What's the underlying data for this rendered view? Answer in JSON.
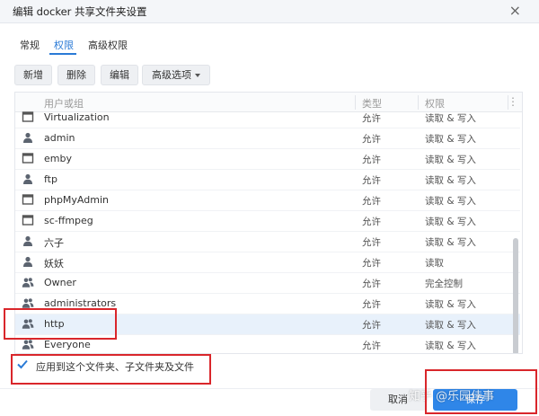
{
  "dialog": {
    "title": "编辑 docker 共享文件夹设置",
    "close_glyph": "×"
  },
  "tabs": [
    {
      "label": "常规"
    },
    {
      "label": "权限"
    },
    {
      "label": "高级权限"
    }
  ],
  "toolbar": {
    "add": "新增",
    "delete": "删除",
    "edit": "编辑",
    "advanced": "高级选项"
  },
  "grid": {
    "columns": {
      "name": "用户或组",
      "type": "类型",
      "permission": "权限"
    },
    "menu_glyph": "⋮",
    "rows": [
      {
        "icon": "app-window-icon",
        "name": "Virtualization",
        "type": "允许",
        "permission": "读取 & 写入"
      },
      {
        "icon": "user-icon",
        "name": "admin",
        "type": "允许",
        "permission": "读取 & 写入"
      },
      {
        "icon": "app-window-icon",
        "name": "emby",
        "type": "允许",
        "permission": "读取 & 写入"
      },
      {
        "icon": "user-icon",
        "name": "ftp",
        "type": "允许",
        "permission": "读取 & 写入"
      },
      {
        "icon": "app-window-icon",
        "name": "phpMyAdmin",
        "type": "允许",
        "permission": "读取 & 写入"
      },
      {
        "icon": "app-window-icon",
        "name": "sc-ffmpeg",
        "type": "允许",
        "permission": "读取 & 写入"
      },
      {
        "icon": "user-icon",
        "name": "六子",
        "type": "允许",
        "permission": "读取 & 写入"
      },
      {
        "icon": "user-icon",
        "name": "妖妖",
        "type": "允许",
        "permission": "读取"
      },
      {
        "icon": "group-icon",
        "name": "Owner",
        "type": "允许",
        "permission": "完全控制"
      },
      {
        "icon": "group-icon",
        "name": "administrators",
        "type": "允许",
        "permission": "读取 & 写入"
      },
      {
        "icon": "group-icon",
        "name": "http",
        "type": "允许",
        "permission": "读取 & 写入"
      },
      {
        "icon": "group-icon",
        "name": "Everyone",
        "type": "允许",
        "permission": "读取 & 写入"
      }
    ]
  },
  "apply_checkbox": {
    "label": "应用到这个文件夹、子文件夹及文件",
    "checked": true
  },
  "footer": {
    "cancel": "取消",
    "save": "保存"
  },
  "watermark": "知乎 @乐园佳事",
  "colors": {
    "accent": "#2a7ad6",
    "save_button": "#2f86e8",
    "highlight": "#d9262b",
    "selected_row": "#e8f1fb"
  }
}
